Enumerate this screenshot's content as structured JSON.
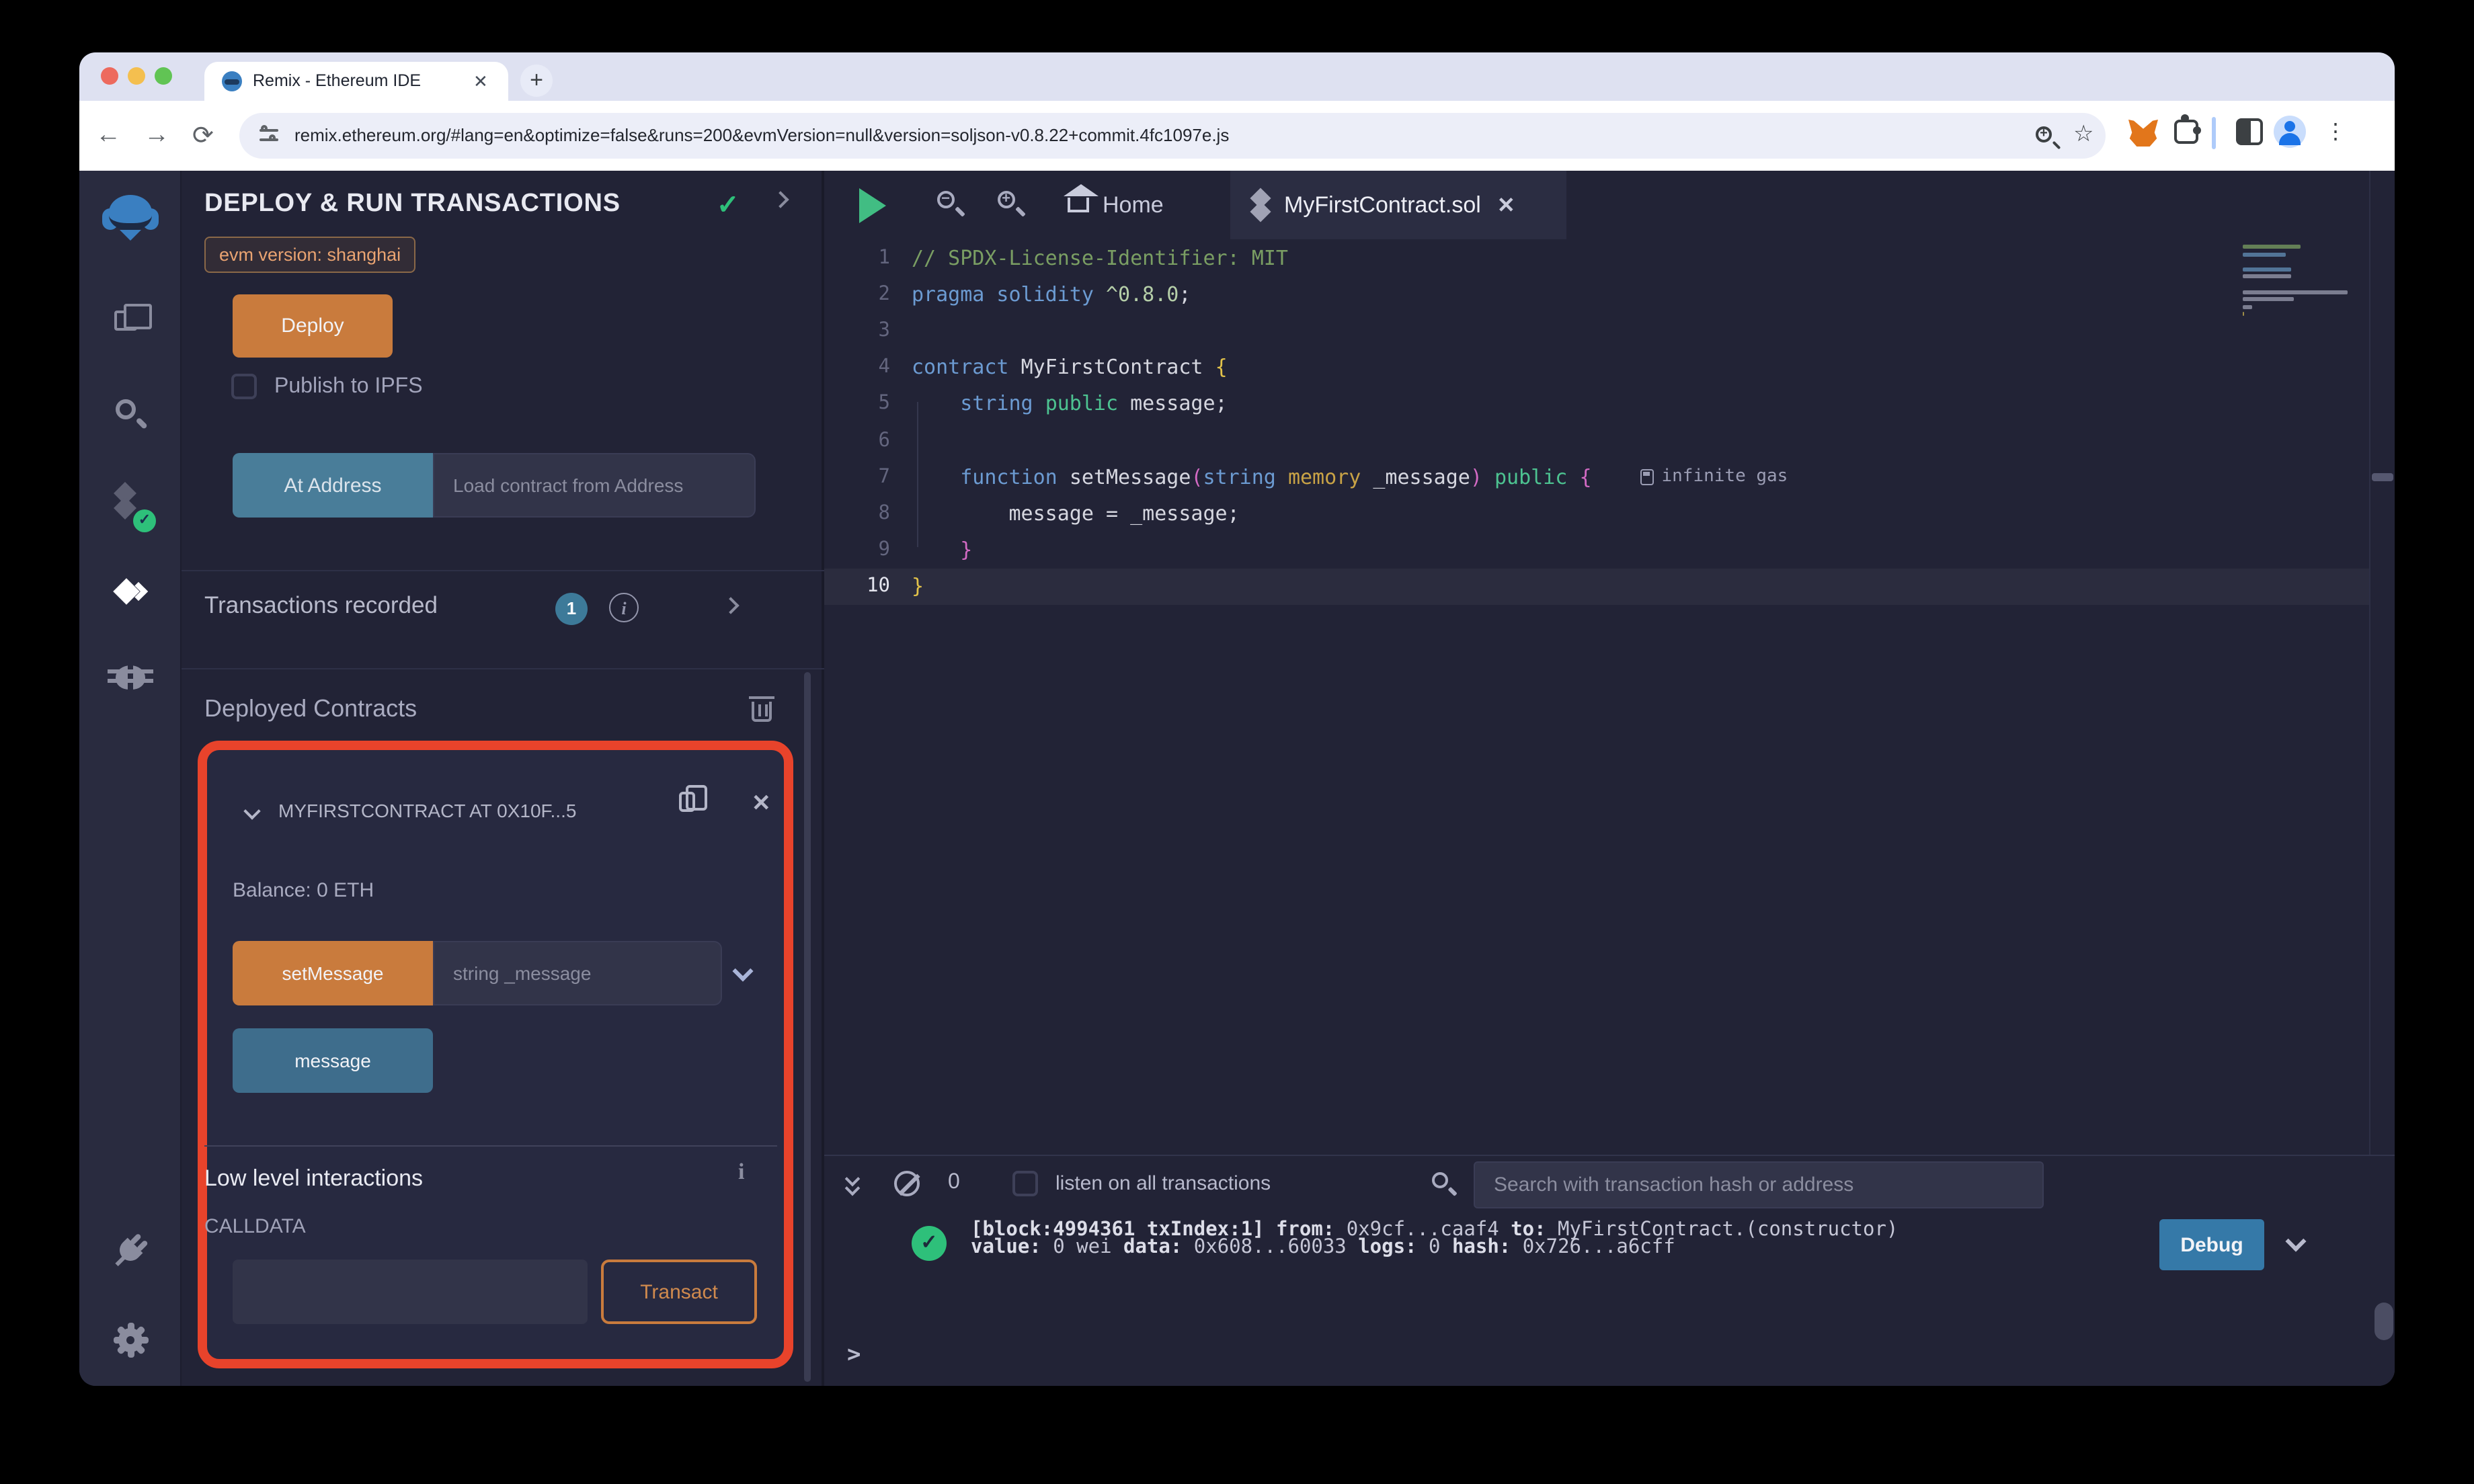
{
  "theme": {
    "accent_red": "#e8432b",
    "accent_orange": "#c97b3d",
    "button_teal": "#497d99",
    "button_blue": "#3e6d8c",
    "debug_blue": "#3579a8",
    "success_green": "#2ec07a",
    "bg_app": "#222336",
    "bg_rail": "#292b3f",
    "bg_card": "#2b2d42",
    "bg_input": "#323449",
    "traffic_red": "#ed6a5e",
    "traffic_yellow": "#f4bf4f",
    "traffic_green": "#61c454"
  },
  "icons": {
    "close": "✕",
    "plus": "+",
    "check": "✓",
    "info": "i",
    "dots": "⋮",
    "back": "←",
    "forward": "→",
    "reload": "⟳",
    "star": "☆",
    "minus": "−"
  },
  "browser": {
    "tab_title": "Remix - Ethereum IDE",
    "url": "remix.ethereum.org/#lang=en&optimize=false&runs=200&evmVersion=null&version=soljson-v0.8.22+commit.4fc1097e.js"
  },
  "side_panel": {
    "title": "DEPLOY & RUN TRANSACTIONS",
    "evm_badge": "evm version: shanghai",
    "deploy_label": "Deploy",
    "publish_label": "Publish to IPFS",
    "at_address_label": "At Address",
    "at_address_placeholder": "Load contract from Address",
    "transactions_label": "Transactions recorded",
    "transactions_count": "1",
    "deployed_label": "Deployed Contracts",
    "contract": {
      "header": "MYFIRSTCONTRACT AT 0X10F...5",
      "balance": "Balance: 0 ETH",
      "set_message_label": "setMessage",
      "set_message_placeholder": "string _message",
      "message_label": "message",
      "low_level_label": "Low level interactions",
      "calldata_label": "CALLDATA",
      "transact_label": "Transact"
    }
  },
  "editor": {
    "home_tab": "Home",
    "file_tab": "MyFirstContract.sol",
    "gas_annotation": "infinite gas",
    "code": {
      "lines": [
        {
          "n": "1",
          "t": [
            {
              "c": "c",
              "s": "// SPDX-License-Identifier: MIT"
            }
          ]
        },
        {
          "n": "2",
          "t": [
            {
              "c": "k",
              "s": "pragma solidity "
            },
            {
              "c": "v",
              "s": "^0.8.0"
            },
            {
              "c": "p",
              "s": ";"
            }
          ]
        },
        {
          "n": "3",
          "t": []
        },
        {
          "n": "4",
          "t": [
            {
              "c": "k",
              "s": "contract "
            },
            {
              "c": "p",
              "s": "MyFirstContract "
            },
            {
              "c": "y",
              "s": "{"
            }
          ]
        },
        {
          "n": "5",
          "t": [
            {
              "c": "p",
              "s": "    "
            },
            {
              "c": "k",
              "s": "string "
            },
            {
              "c": "g",
              "s": "public "
            },
            {
              "c": "p",
              "s": "message;"
            }
          ]
        },
        {
          "n": "6",
          "t": []
        },
        {
          "n": "7",
          "gas": true,
          "t": [
            {
              "c": "p",
              "s": "    "
            },
            {
              "c": "k",
              "s": "function "
            },
            {
              "c": "p",
              "s": "setMessage"
            },
            {
              "c": "pk",
              "s": "("
            },
            {
              "c": "k",
              "s": "string "
            },
            {
              "c": "o",
              "s": "memory "
            },
            {
              "c": "p",
              "s": "_message"
            },
            {
              "c": "pk",
              "s": ")"
            },
            {
              "c": "p",
              "s": " "
            },
            {
              "c": "g",
              "s": "public"
            },
            {
              "c": "p",
              "s": " "
            },
            {
              "c": "pk",
              "s": "{"
            }
          ]
        },
        {
          "n": "8",
          "t": [
            {
              "c": "p",
              "s": "        message = _message;"
            }
          ]
        },
        {
          "n": "9",
          "t": [
            {
              "c": "p",
              "s": "    "
            },
            {
              "c": "pk",
              "s": "}"
            }
          ]
        },
        {
          "n": "10",
          "active": true,
          "t": [
            {
              "c": "y",
              "s": "}"
            }
          ]
        }
      ]
    }
  },
  "terminal": {
    "listen_count": "0",
    "listen_label": "listen on all transactions",
    "search_placeholder": "Search with transaction hash or address",
    "log_lines": [
      [
        {
          "b": 1,
          "s": "[block:4994361 txIndex:1]"
        },
        {
          "s": " "
        },
        {
          "b": 1,
          "s": "from:"
        },
        {
          "s": " 0x9cf...caaf4 "
        },
        {
          "b": 1,
          "s": "to:"
        },
        {
          "s": " MyFirstContract.(constructor)"
        }
      ],
      [
        {
          "b": 1,
          "s": "value:"
        },
        {
          "s": " 0 wei "
        },
        {
          "b": 1,
          "s": "data:"
        },
        {
          "s": " 0x608...60033 "
        },
        {
          "b": 1,
          "s": "logs:"
        },
        {
          "s": " 0 "
        },
        {
          "b": 1,
          "s": "hash:"
        },
        {
          "s": " 0x726...a6cff"
        }
      ]
    ],
    "debug_label": "Debug",
    "prompt": ">"
  }
}
